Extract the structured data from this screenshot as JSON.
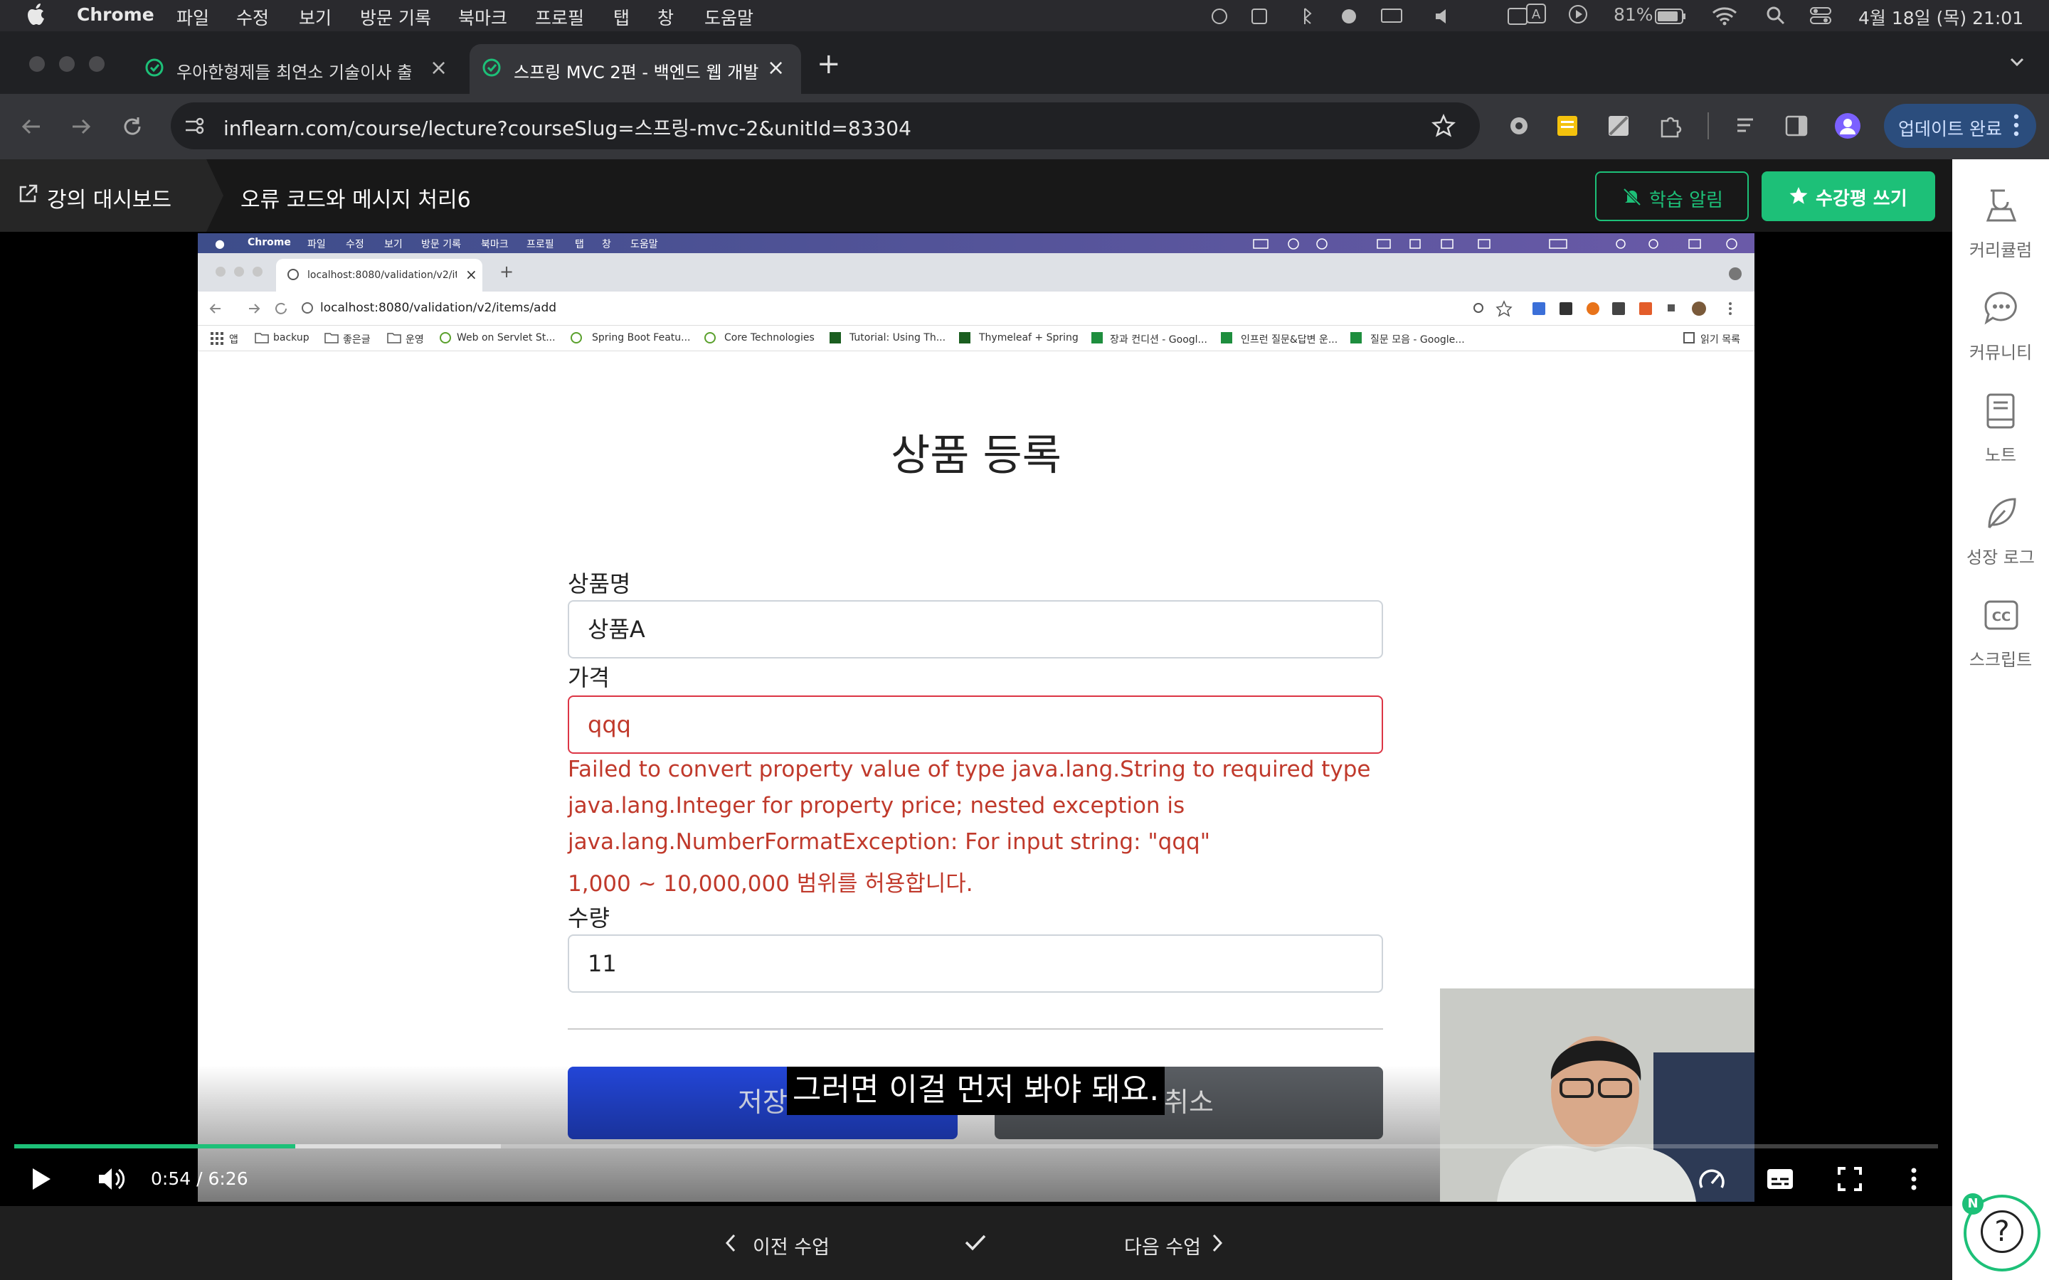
{
  "menubar": {
    "app": "Chrome",
    "items": [
      "파일",
      "수정",
      "보기",
      "방문 기록",
      "북마크",
      "프로필",
      "탭",
      "창",
      "도움말"
    ],
    "battery": "81%",
    "datetime": "4월 18일 (목) 21:01"
  },
  "tabs": [
    {
      "title": "우아한형제들 최연소 기술이사 출신"
    },
    {
      "title": "스프링 MVC 2편 - 백엔드 웹 개발"
    }
  ],
  "omnibox": {
    "url": "inflearn.com/course/lecture?courseSlug=스프링-mvc-2&unitId=83304"
  },
  "update_button": "업데이트 완료",
  "header": {
    "dashboard": "강의 대시보드",
    "lecture_title": "오류 코드와 메시지 처리6",
    "notify_btn": "학습 알림",
    "review_btn": "수강평 쓰기"
  },
  "sidebar": {
    "items": [
      {
        "label": "커리큘럼",
        "icon": "curriculum-icon"
      },
      {
        "label": "커뮤니티",
        "icon": "chat-icon"
      },
      {
        "label": "노트",
        "icon": "note-icon"
      },
      {
        "label": "성장 로그",
        "icon": "leaf-icon"
      },
      {
        "label": "스크립트",
        "icon": "cc-icon"
      }
    ]
  },
  "video": {
    "inner_menubar": {
      "app": "Chrome",
      "items": [
        "파일",
        "수정",
        "보기",
        "방문 기록",
        "북마크",
        "프로필",
        "탭",
        "창",
        "도움말"
      ]
    },
    "inner_tab": "localhost:8080/validation/v2/it",
    "inner_url": "localhost:8080/validation/v2/items/add",
    "bookmarks": [
      "앱",
      "backup",
      "좋은글",
      "운영",
      "Web on Servlet St...",
      "Spring Boot Featu...",
      "Core Technologies",
      "Tutorial: Using Th...",
      "Thymeleaf + Spring",
      "장과 컨디션 - Googl...",
      "인프런 질문&답변 운...",
      "질문 모음 - Google..."
    ],
    "reading_list": "읽기 목록",
    "form": {
      "title": "상품 등록",
      "name_label": "상품명",
      "name_value": "상품A",
      "price_label": "가격",
      "price_value": "qqq",
      "errors": [
        "Failed to convert property value of type java.lang.String to required type",
        "java.lang.Integer for property price; nested exception is",
        "java.lang.NumberFormatException: For input string: \"qqq\"",
        "1,000 ~ 10,000,000 범위를 허용합니다."
      ],
      "qty_label": "수량",
      "qty_value": "11",
      "save_btn": "저장",
      "cancel_btn": "취소"
    },
    "subtitle": "그러면 이걸 먼저 봐야 돼요.",
    "time": "0:54 / 6:26",
    "progress": 0.146,
    "buffered": 0.253
  },
  "bottom": {
    "prev": "이전 수업",
    "next": "다음 수업"
  },
  "help_badge": "N",
  "colors": {
    "accent_green": "#1dc078",
    "error_red": "#c0392b",
    "save_blue": "#2346d8"
  }
}
